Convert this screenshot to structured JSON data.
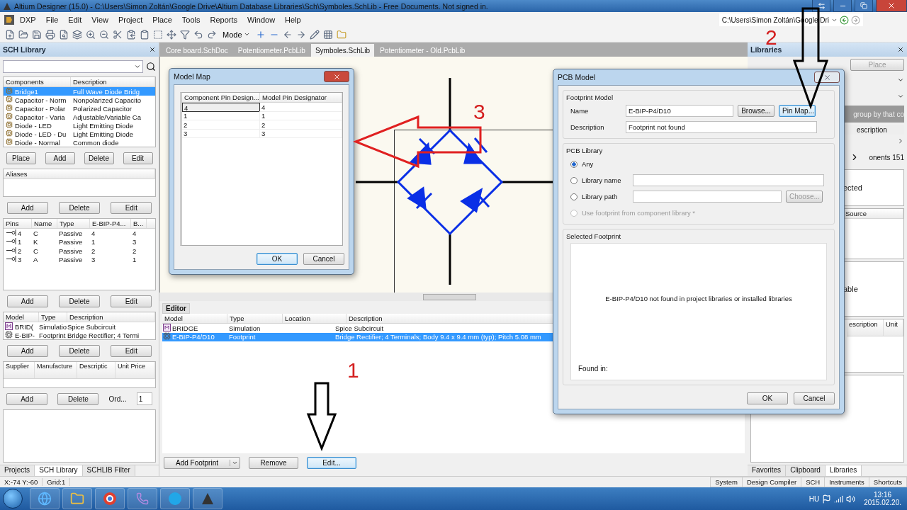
{
  "window": {
    "title": "Altium Designer (15.0) - C:\\Users\\Simon Zoltán\\Google Drive\\Altium Database Libraries\\Sch\\Symboles.SchLib - Free Documents. Not signed in."
  },
  "menu": [
    "DXP",
    "File",
    "Edit",
    "View",
    "Project",
    "Place",
    "Tools",
    "Reports",
    "Window",
    "Help"
  ],
  "toolbar": {
    "mode": "Mode",
    "path": "C:\\Users\\Simon Zoltán\\Google Dri"
  },
  "left_panel": {
    "title": "SCH Library",
    "components": {
      "columns": [
        "Components",
        "Description"
      ],
      "rows": [
        {
          "name": "Bridge1",
          "description": "Full Wave Diode Bridg",
          "selected": true
        },
        {
          "name": "Capacitor - Norm",
          "description": "Nonpolarized Capacito",
          "selected": false
        },
        {
          "name": "Capacitor - Polar",
          "description": "Polarized Capacitor",
          "selected": false
        },
        {
          "name": "Capacitor - Varia",
          "description": "Adjustable/Variable Ca",
          "selected": false
        },
        {
          "name": "Diode - LED",
          "description": "Light Emitting Diode",
          "selected": false
        },
        {
          "name": "Diode - LED - Du",
          "description": "Light Emitting Diode",
          "selected": false
        },
        {
          "name": "Diode - Normal",
          "description": "Common diode",
          "selected": false
        }
      ]
    },
    "component_buttons": [
      "Place",
      "Add",
      "Delete",
      "Edit"
    ],
    "aliases": {
      "columns": [
        "Aliases"
      ]
    },
    "alias_buttons": [
      "Add",
      "Delete",
      "Edit"
    ],
    "pins": {
      "columns": [
        "Pins",
        "Name",
        "Type",
        "E-BIP-P4...",
        "B..."
      ],
      "rows": [
        [
          "4",
          "C",
          "Passive",
          "4",
          "4"
        ],
        [
          "1",
          "K",
          "Passive",
          "1",
          "3"
        ],
        [
          "2",
          "C",
          "Passive",
          "2",
          "2"
        ],
        [
          "3",
          "A",
          "Passive",
          "3",
          "1"
        ]
      ]
    },
    "pin_buttons": [
      "Add",
      "Delete",
      "Edit"
    ],
    "models": {
      "columns": [
        "Model",
        "Type",
        "Description"
      ],
      "rows": [
        {
          "kind": "simulation",
          "model": "BRID(",
          "type": "Simulatio",
          "description": "Spice Subcircuit"
        },
        {
          "kind": "footprint",
          "model": "E-BIP-",
          "type": "Footprint",
          "description": "Bridge Rectifier; 4 Termi"
        }
      ]
    },
    "model_buttons": [
      "Add",
      "Delete",
      "Edit"
    ],
    "suppliers": {
      "columns": [
        "Supplier",
        "Manufacture",
        "Descriptic",
        "Unit Price"
      ]
    },
    "supplier_buttons": [
      "Add",
      "Delete"
    ],
    "order_label": "Ord...",
    "order_value": "1",
    "tabs": [
      {
        "label": "Projects",
        "selected": false
      },
      {
        "label": "SCH Library",
        "selected": true
      },
      {
        "label": "SCHLIB Filter",
        "selected": false
      }
    ]
  },
  "document_tabs": [
    {
      "label": "Core board.SchDoc",
      "selected": false
    },
    {
      "label": "Potentiometer.PcbLib",
      "selected": false
    },
    {
      "label": "Symboles.SchLib",
      "selected": true
    },
    {
      "label": "Potentiometer - Old.PcbLib",
      "selected": false
    }
  ],
  "editor": {
    "title": "Editor",
    "columns": [
      "Model",
      "Type",
      "Location",
      "Description"
    ],
    "rows": [
      {
        "kind": "simulation",
        "model": "BRIDGE",
        "type": "Simulation",
        "description": "Spice Subcircuit",
        "selected": false
      },
      {
        "kind": "footprint",
        "model": "E-BIP-P4/D10",
        "type": "Footprint",
        "description": "Bridge Rectifier; 4 Terminals; Body 9.4 x 9.4 mm (typ); Pitch 5.08 mm",
        "selected": true
      }
    ],
    "buttons": [
      {
        "label": "Add Footprint",
        "kind": "split",
        "focused": false
      },
      {
        "label": "Remove",
        "kind": "plain",
        "focused": false
      },
      {
        "label": "Edit...",
        "kind": "plain",
        "focused": true
      }
    ]
  },
  "model_map": {
    "title": "Model Map",
    "columns": [
      "Component Pin Design...",
      "Model Pin Designator"
    ],
    "rows": [
      [
        "4",
        "4"
      ],
      [
        "1",
        "1"
      ],
      [
        "2",
        "2"
      ],
      [
        "3",
        "3"
      ]
    ],
    "buttons": [
      {
        "label": "OK",
        "focused": true
      },
      {
        "label": "Cancel",
        "focused": false
      }
    ]
  },
  "pcb_model": {
    "title": "PCB Model",
    "footprint_model": {
      "title": "Footprint Model",
      "name_label": "Name",
      "name_value": "E-BIP-P4/D10",
      "browse": "Browse...",
      "pin_map": "Pin Map...",
      "description_label": "Description",
      "description_value": "Footprint not found"
    },
    "pcb_library": {
      "title": "PCB Library",
      "options": [
        {
          "label": "Any",
          "selected": true,
          "disabled": false,
          "kind": "plain"
        },
        {
          "label": "Library name",
          "selected": false,
          "disabled": false,
          "kind": "field"
        },
        {
          "label": "Library path",
          "selected": false,
          "disabled": false,
          "kind": "path"
        },
        {
          "label": "Use footprint from component library *",
          "selected": false,
          "disabled": true,
          "kind": "plain"
        }
      ],
      "choose_button": {
        "label": "Choose...",
        "disabled": true
      }
    },
    "selected_footprint": {
      "title": "Selected Footprint",
      "message": "E-BIP-P4/D10 not found in project libraries or installed libraries",
      "found_in": "Found in:"
    },
    "buttons": [
      {
        "label": "OK",
        "focused": false
      },
      {
        "label": "Cancel",
        "focused": false
      }
    ]
  },
  "libraries_panel": {
    "title": "Libraries",
    "place_button": {
      "label": "Place",
      "disabled": true
    },
    "group_hint": "group by that co",
    "column": "escription",
    "count": "onents 151",
    "fragment_1": "ected",
    "source_column": "Source",
    "fragment_2": "able",
    "columns": [
      "escription",
      "Unit"
    ],
    "tabs": [
      {
        "label": "Favorites",
        "selected": false
      },
      {
        "label": "Clipboard",
        "selected": false
      },
      {
        "label": "Libraries",
        "selected": true
      }
    ]
  },
  "annotations": [
    {
      "label": "1"
    },
    {
      "label": "2"
    },
    {
      "label": "3"
    }
  ],
  "status_bar": {
    "left": [
      "X:-74 Y:-60",
      "Grid:1"
    ],
    "right": [
      "System",
      "Design Compiler",
      "SCH",
      "Instruments",
      "Shortcuts"
    ]
  },
  "taskbar": {
    "language": "HU",
    "time": "13:16",
    "date": "2015.02.20."
  }
}
